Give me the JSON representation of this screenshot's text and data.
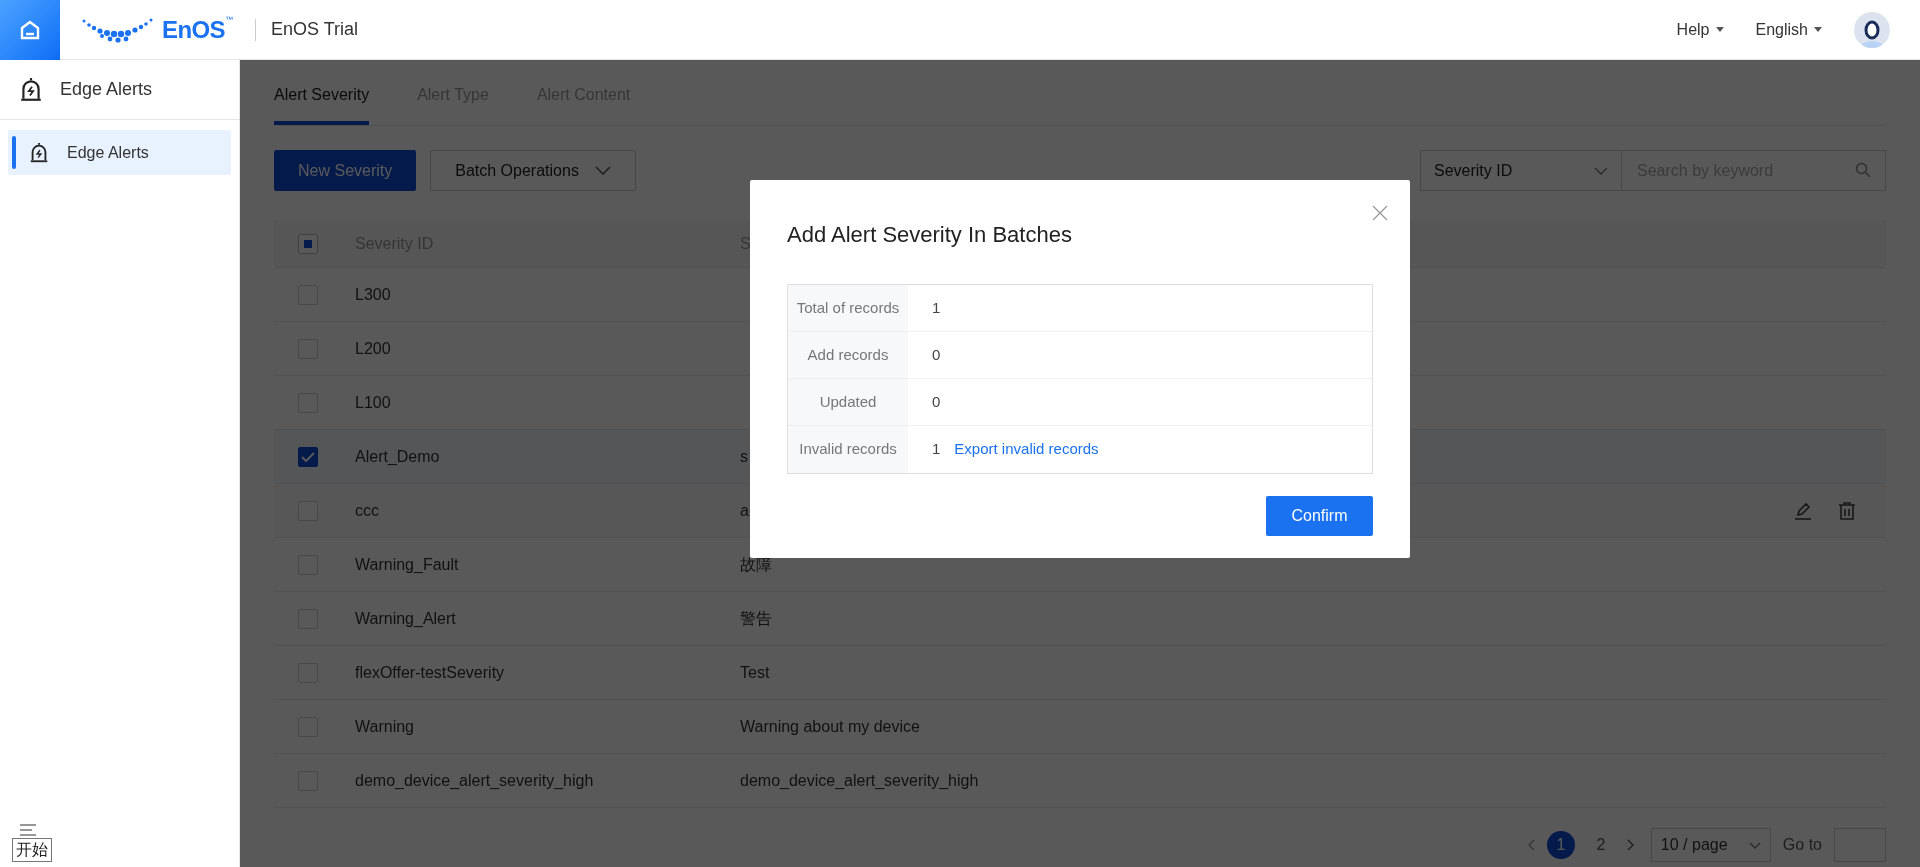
{
  "header": {
    "logo": "EnOS",
    "logo_mark": "™",
    "app_title": "EnOS Trial",
    "menus": [
      {
        "label": "Help"
      },
      {
        "label": "English"
      }
    ]
  },
  "sidebar": {
    "title": "Edge Alerts",
    "items": [
      {
        "label": "Edge Alerts",
        "selected": true
      }
    ]
  },
  "tabs": [
    {
      "label": "Alert Severity",
      "selected": true
    },
    {
      "label": "Alert Type",
      "selected": false
    },
    {
      "label": "Alert Content",
      "selected": false
    }
  ],
  "toolbar": {
    "primary_button": "New Severity",
    "batch_button": "Batch Operations",
    "filter_select": "Severity ID",
    "search": {
      "placeholder": "Search by keyword"
    }
  },
  "table": {
    "header_indeterminate": true,
    "columns": [
      "Severity ID",
      "S"
    ],
    "rows": [
      {
        "id": "L300",
        "checked": false,
        "hovered": false
      },
      {
        "id": "L200",
        "checked": false,
        "hovered": false
      },
      {
        "id": "L100",
        "checked": false,
        "hovered": false
      },
      {
        "id": "Alert_Demo",
        "name": "s",
        "checked": true,
        "hovered": false
      },
      {
        "id": "ccc",
        "name": "a",
        "checked": false,
        "hovered": true
      },
      {
        "id": "Warning_Fault",
        "name": "故障",
        "checked": false,
        "hovered": false
      },
      {
        "id": "Warning_Alert",
        "name": "警告",
        "checked": false,
        "hovered": false
      },
      {
        "id": "flexOffer-testSeverity",
        "name": "Test",
        "checked": false,
        "hovered": false
      },
      {
        "id": "Warning",
        "name": "Warning about my device",
        "checked": false,
        "hovered": false
      },
      {
        "id": "demo_device_alert_severity_high",
        "name": "demo_device_alert_severity_high",
        "checked": false,
        "hovered": false
      }
    ]
  },
  "pagination": {
    "pages": [
      {
        "label": "1",
        "selected": true
      },
      {
        "label": "2",
        "selected": false
      }
    ],
    "page_size": "10 / page",
    "goto_label": "Go to"
  },
  "start_tip": "开始",
  "modal": {
    "title": "Add Alert Severity In Batches",
    "rows": [
      {
        "label": "Total of records",
        "value": "1"
      },
      {
        "label": "Add records",
        "value": "0"
      },
      {
        "label": "Updated",
        "value": "0"
      },
      {
        "label": "Invalid records",
        "value": "1",
        "link": "Export invalid records"
      }
    ],
    "confirm": "Confirm"
  }
}
